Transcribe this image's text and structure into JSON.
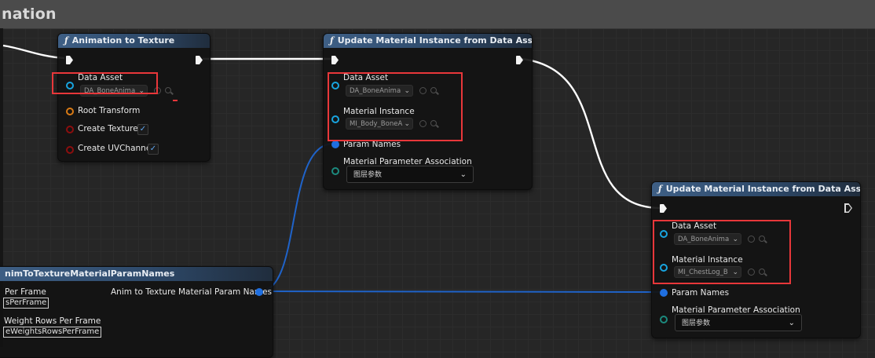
{
  "graph": {
    "title": "nation"
  },
  "colors": {
    "node_title_blue": "#3e5f85",
    "object_pin": "#18a5e0",
    "struct_pin": "#d97b16",
    "bool_pin": "#8c0e0e",
    "array_pin": "#1f6fe0",
    "assoc_pin": "#1c8a7e",
    "wire_exec": "#ffffff",
    "wire_array": "#1f63c9",
    "highlight": "#e8373a"
  },
  "nodes": {
    "anim_to_texture": {
      "title": "Animation to Texture",
      "pins": {
        "data_asset": {
          "label": "Data Asset",
          "value": "DA_BoneAnima"
        },
        "root_transform": {
          "label": "Root Transform"
        },
        "create_textures": {
          "label": "Create Textures",
          "checked": true
        },
        "create_uv_channel": {
          "label": "Create UVChannel",
          "checked": true
        }
      }
    },
    "update_1": {
      "title": "Update Material Instance from Data Asset",
      "pins": {
        "data_asset": {
          "label": "Data Asset",
          "value": "DA_BoneAnima"
        },
        "material_instance": {
          "label": "Material Instance",
          "value": "MI_Body_BoneA"
        },
        "param_names": {
          "label": "Param Names"
        },
        "assoc": {
          "label": "Material Parameter Association",
          "value": "图层参数"
        }
      }
    },
    "update_2": {
      "title": "Update Material Instance from Data Asset",
      "pins": {
        "data_asset": {
          "label": "Data Asset",
          "value": "DA_BoneAnima"
        },
        "material_instance": {
          "label": "Material Instance",
          "value": "MI_ChestLog_B"
        },
        "param_names": {
          "label": "Param Names"
        },
        "assoc": {
          "label": "Material Parameter Association",
          "value": "图层参数"
        }
      }
    },
    "make_params": {
      "title": "nimToTextureMaterialParamNames",
      "output_label": "Anim to Texture Material Param Names",
      "field1_label": "Per Frame",
      "field1_value": "sPerFrame",
      "field2_label": "Weight Rows Per Frame",
      "field2_value": "eWeightsRowsPerFrame"
    }
  }
}
